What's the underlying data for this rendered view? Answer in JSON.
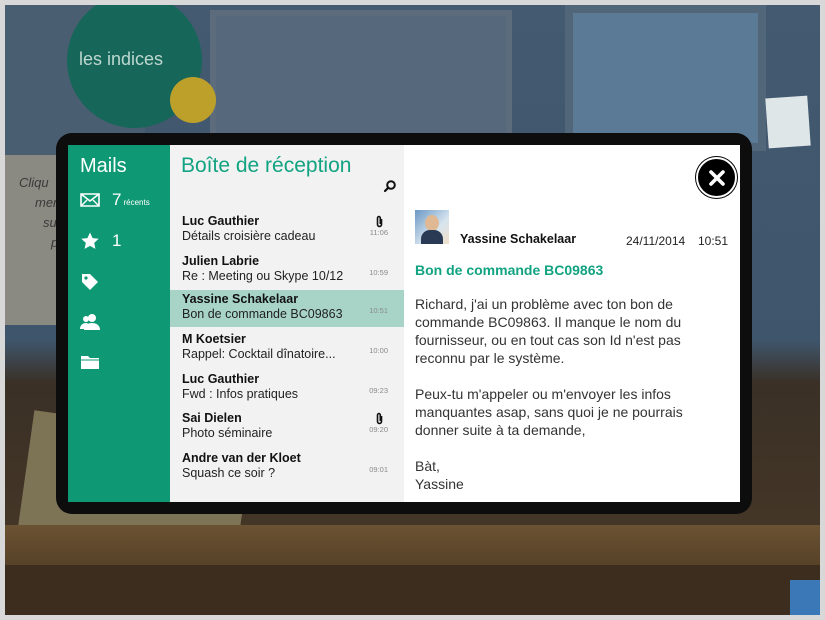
{
  "background": {
    "clue_label": "les indices",
    "hint_lines": [
      "Cliqu",
      "men",
      "su",
      "p"
    ]
  },
  "sidebar": {
    "title": "Mails",
    "inbox_count": "7",
    "inbox_count_suffix": "récents",
    "starred_count": "1",
    "icons": [
      "envelope-icon",
      "star-icon",
      "tag-icon",
      "contacts-icon",
      "folder-icon"
    ]
  },
  "inbox": {
    "title": "Boîte de réception",
    "items": [
      {
        "sender": "Luc Gauthier",
        "subject": "Détails croisière cadeau",
        "time": "11:06",
        "attachment": true,
        "selected": false
      },
      {
        "sender": "Julien Labrie",
        "subject": "Re : Meeting ou Skype 10/12",
        "time": "10:59",
        "attachment": false,
        "selected": false
      },
      {
        "sender": "Yassine Schakelaar",
        "subject": "Bon de commande BC09863",
        "time": "10:51",
        "attachment": false,
        "selected": true
      },
      {
        "sender": "M Koetsier",
        "subject": "Rappel: Cocktail dînatoire...",
        "time": "10:00",
        "attachment": false,
        "selected": false
      },
      {
        "sender": "Luc Gauthier",
        "subject": "Fwd : Infos pratiques",
        "time": "09:23",
        "attachment": false,
        "selected": false
      },
      {
        "sender": "Sai Dielen",
        "subject": "Photo séminaire",
        "time": "09:20",
        "attachment": true,
        "selected": false
      },
      {
        "sender": "Andre van der Kloet",
        "subject": "Squash ce soir ?",
        "time": "09:01",
        "attachment": false,
        "selected": false
      }
    ]
  },
  "reader": {
    "from": "Yassine Schakelaar",
    "date": "24/11/2014",
    "time": "10:51",
    "subject": "Bon de commande BC09863",
    "paragraphs": [
      "Richard, j'ai un problème avec ton bon de commande BC09863.  Il manque le nom du fournisseur, ou en tout cas son Id n'est pas reconnu par le système.",
      "Peux-tu m'appeler ou m'envoyer les infos manquantes asap, sans quoi je ne pourrais donner suite à ta demande,",
      "Bàt,\nYassine"
    ]
  },
  "colors": {
    "accent": "#0e9974",
    "accent_text": "#12a382",
    "selected_row": "#a8d4c8"
  }
}
